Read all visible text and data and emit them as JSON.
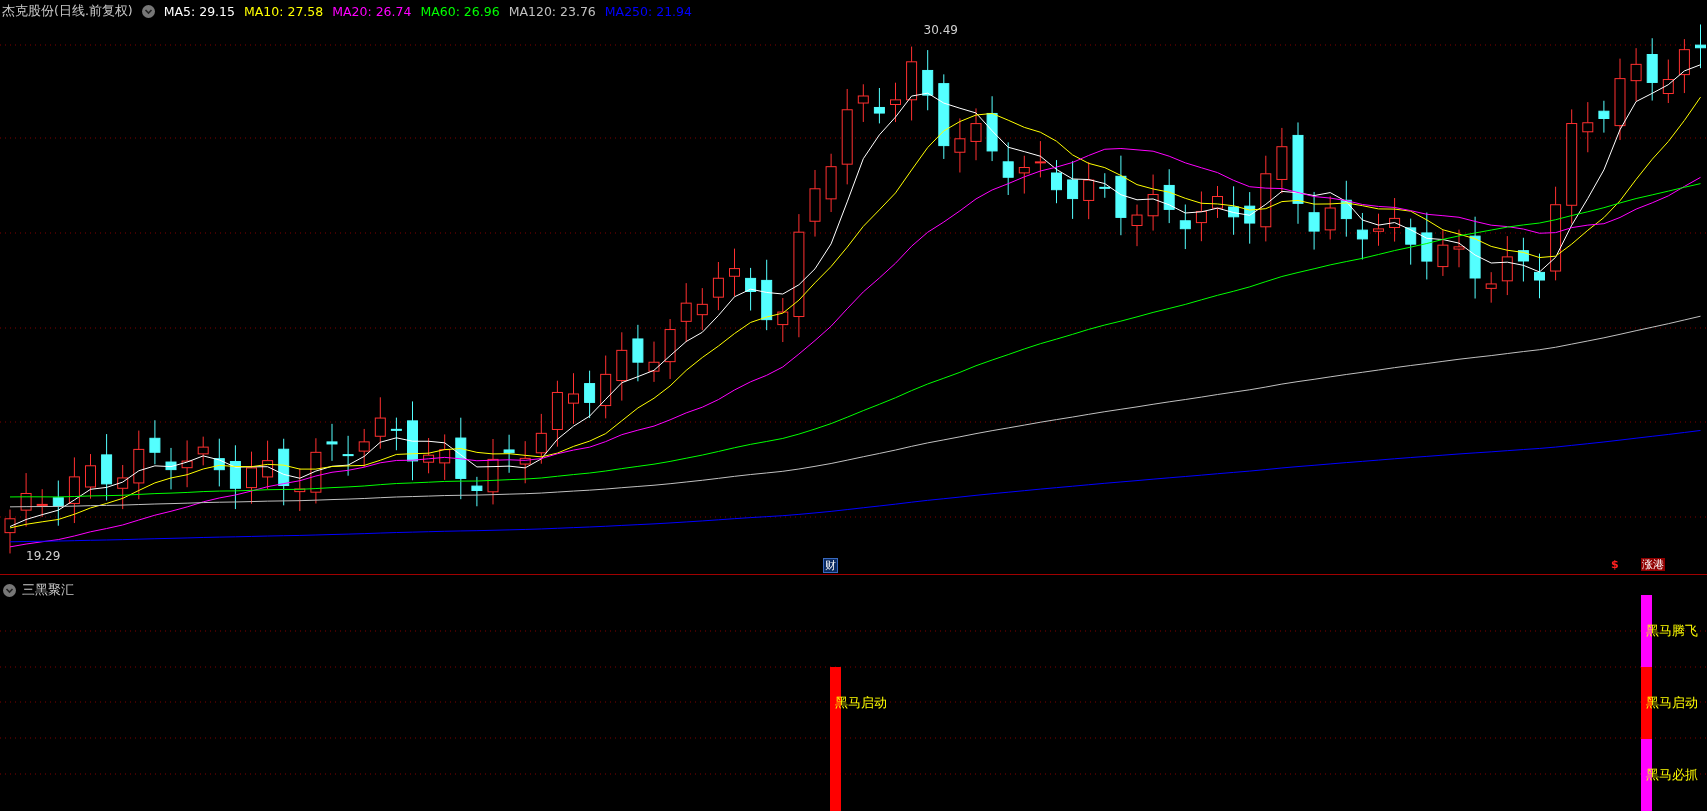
{
  "header": {
    "title": "杰克股份(日线.前复权)",
    "ma": [
      {
        "label": "MA5: 29.15",
        "color": "#ffffff"
      },
      {
        "label": "MA10: 27.58",
        "color": "#ffff00"
      },
      {
        "label": "MA20: 26.74",
        "color": "#ff00ff"
      },
      {
        "label": "MA60: 26.96",
        "color": "#00ff00"
      },
      {
        "label": "MA120: 23.76",
        "color": "#c0c0c0"
      },
      {
        "label": "MA250: 21.94",
        "color": "#0000ff"
      }
    ]
  },
  "price_chart": {
    "high_label": "30.49",
    "low_label": "19.29",
    "markers": [
      {
        "kind": "finance",
        "text": "财"
      },
      {
        "kind": "dollar",
        "text": "$"
      },
      {
        "kind": "limit",
        "text": "涨港"
      }
    ]
  },
  "indicator": {
    "title": "三黑聚汇",
    "signals": [
      {
        "segments": [
          {
            "label": "黑马启动",
            "color": "#ff0000"
          }
        ]
      },
      {
        "segments": [
          {
            "label": "黑马腾飞",
            "color": "#ff00ff"
          },
          {
            "label": "黑马启动",
            "color": "#ff0000"
          },
          {
            "label": "黑马必抓",
            "color": "#ff00ff"
          }
        ]
      }
    ]
  }
}
